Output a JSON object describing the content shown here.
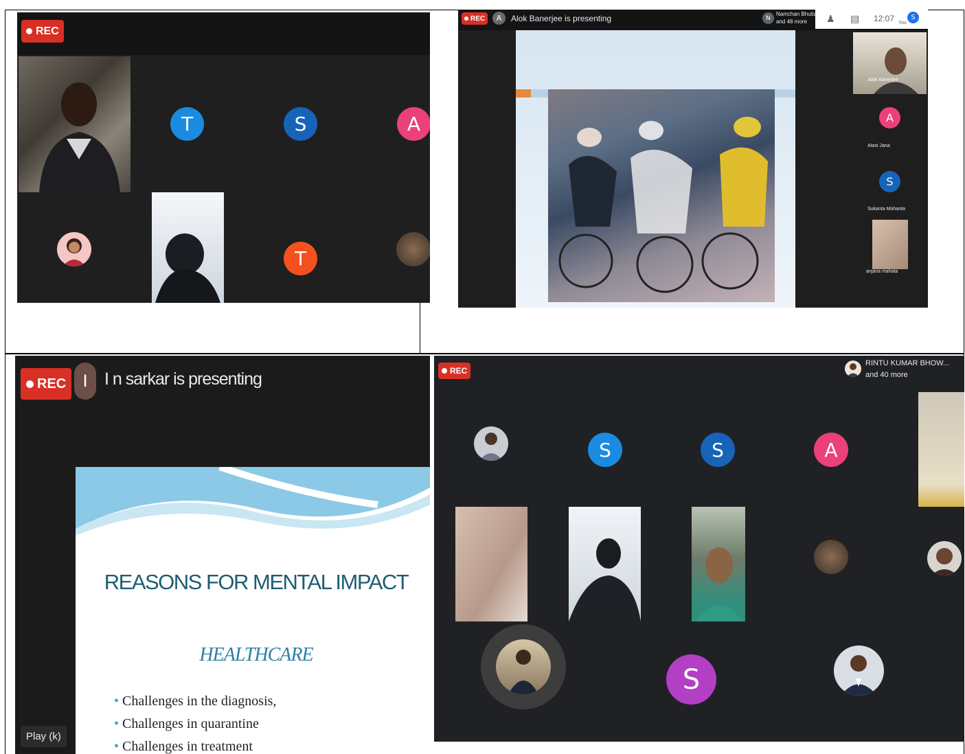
{
  "panel1": {
    "rec_label": "REC",
    "avatars": [
      {
        "letter": "T",
        "color": "#1a8be0"
      },
      {
        "letter": "S",
        "color": "#1763b8"
      },
      {
        "letter": "A",
        "color": "#ec407a"
      },
      {
        "letter": "T",
        "color": "#f4511e"
      }
    ]
  },
  "panel2": {
    "rec_label": "REC",
    "presenter_initial": "A",
    "presenting_text": "Alok Banerjee is presenting",
    "participants_initial": "N",
    "participants_line1": "Namchan Bhutia",
    "participants_line2": "and 48 more",
    "clock": "12:07",
    "you_initial": "S",
    "you_label": "You",
    "sidebar": [
      {
        "name": "Alok Banerjee"
      },
      {
        "initial": "A",
        "name": "Atasi Jana",
        "color": "#ec407a"
      },
      {
        "initial": "S",
        "name": "Sukanta Mohanta",
        "color": "#1763b8"
      },
      {
        "name": "anjana mahata"
      }
    ]
  },
  "panel3": {
    "rec_label": "REC",
    "presenter_initial": "I",
    "presenting_text": "I n sarkar is presenting",
    "slide_title": "REASONS FOR MENTAL IMPACT",
    "slide_subtitle": "HEALTHCARE",
    "bullets": [
      "Challenges in the diagnosis,",
      "Challenges in quarantine",
      "Challenges in treatment"
    ],
    "play_label": "Play (k)"
  },
  "panel4": {
    "rec_label": "REC",
    "participants_line1": "RINTU KUMAR BHOW...",
    "participants_line2": "and 40 more",
    "avatars": [
      {
        "letter": "S",
        "color": "#1a8be0"
      },
      {
        "letter": "S",
        "color": "#1763b8"
      },
      {
        "letter": "A",
        "color": "#ec407a"
      },
      {
        "letter": "S",
        "color": "#b23fc4"
      }
    ]
  }
}
